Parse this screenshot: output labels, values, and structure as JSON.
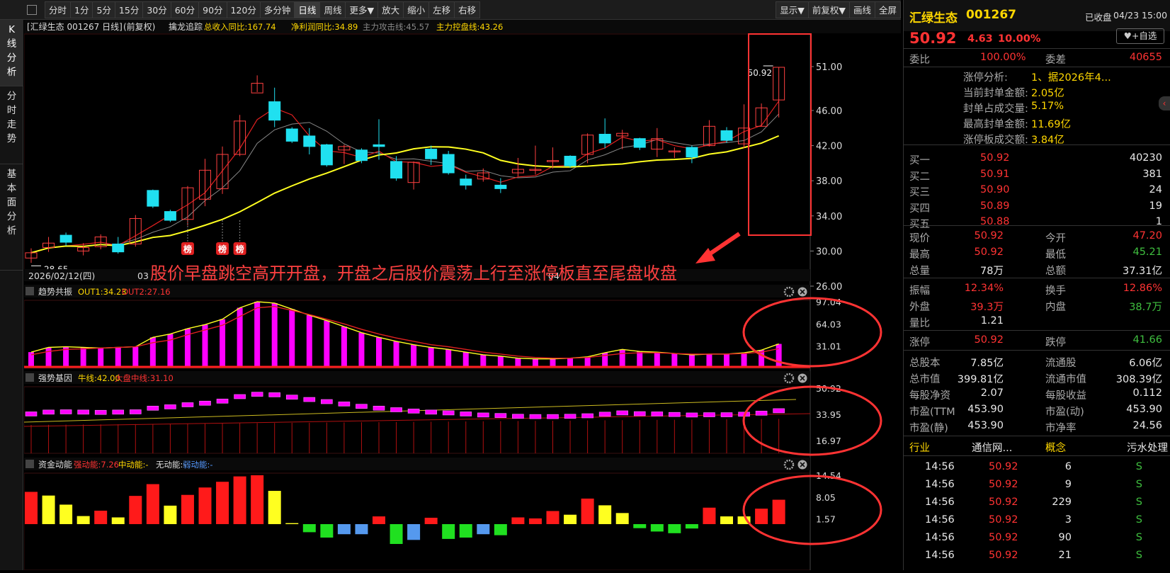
{
  "toolbar": {
    "items": [
      "分时",
      "1分",
      "5分",
      "15分",
      "30分",
      "60分",
      "90分",
      "120分",
      "多分钟",
      "日线",
      "周线",
      "更多▼",
      "放大",
      "缩小",
      "左移",
      "右移"
    ],
    "right_items": [
      "显示▼",
      "前复权▼",
      "画线",
      "全屏"
    ],
    "active": "日线"
  },
  "left_tabs": [
    [
      "K",
      "线",
      "分",
      "析"
    ],
    [
      "分",
      "时",
      "走",
      "势"
    ],
    [
      "基",
      "本",
      "面",
      "分",
      "析"
    ]
  ],
  "chart_header": {
    "title": "[汇绿生态 001267 日线]",
    "adj": "(前复权)",
    "indicator": "擒龙追踪",
    "total_revenue": "总收入同比:167.74",
    "net_profit": "净利润同比:34.89",
    "attack_line": "主力攻击线:45.57",
    "control_line": "主力控盘线:43.26"
  },
  "price_axis": [
    "51.00",
    "46.00",
    "42.00",
    "38.00",
    "34.00",
    "30.00",
    "26.00"
  ],
  "price_labels": {
    "high": "50.92",
    "low": "28.65"
  },
  "date_labels": {
    "start": "2026/02/12(四)",
    "m3": "03",
    "m4": "04"
  },
  "bang": [
    "榜",
    "榜",
    "榜"
  ],
  "annotation": "股价早盘跳空高开开盘，开盘之后股价震荡上行至涨停板直至尾盘收盘",
  "panel1": {
    "name": "趋势共振",
    "out1": "OUT1:34.23",
    "out2": "OUT2:27.16",
    "axis": [
      "97.04",
      "64.03",
      "31.01"
    ]
  },
  "panel2": {
    "name": "强势基因",
    "bull": "牛线:42.00",
    "market": "大盘中线:31.10",
    "axis": [
      "50.92",
      "33.95",
      "16.97"
    ]
  },
  "panel3": {
    "name": "资金动能",
    "strong": "强动能:7.26",
    "mid": "中动能:-",
    "none": "无动能:-",
    "weak": "弱动能:-",
    "axis": [
      "14.54",
      "8.05",
      "1.57"
    ]
  },
  "chart_data": {
    "type": "candlestick",
    "dates": {
      "start": "2026/02/12(四)"
    },
    "candles": [
      [
        29.2,
        29.8,
        30.3,
        28.65
      ],
      [
        30.4,
        30.9,
        31.6,
        29.9
      ],
      [
        31.8,
        31.0,
        32.1,
        30.6
      ],
      [
        30.0,
        30.4,
        30.9,
        29.5
      ],
      [
        30.5,
        31.6,
        31.9,
        30.2
      ],
      [
        30.8,
        29.9,
        31.6,
        29.7
      ],
      [
        30.8,
        33.7,
        34.1,
        30.5
      ],
      [
        36.9,
        35.1,
        37.0,
        34.9
      ],
      [
        34.5,
        33.5,
        34.7,
        33.3
      ],
      [
        33.6,
        37.2,
        37.4,
        32.9
      ],
      [
        35.9,
        39.2,
        40.5,
        35.1
      ],
      [
        37.1,
        41.0,
        41.9,
        36.5
      ],
      [
        41.0,
        44.8,
        45.5,
        40.8
      ],
      [
        48.0,
        49.1,
        50.0,
        48.1
      ],
      [
        47.0,
        44.9,
        48.6,
        44.1
      ],
      [
        43.9,
        42.5,
        44.1,
        42.3
      ],
      [
        43.1,
        41.9,
        44.0,
        41.0
      ],
      [
        42.1,
        39.8,
        42.2,
        39.6
      ],
      [
        41.5,
        41.9,
        42.1,
        39.9
      ],
      [
        41.5,
        40.3,
        41.7,
        40.0
      ],
      [
        42.1,
        41.9,
        45.0,
        40.4
      ],
      [
        40.2,
        38.3,
        40.8,
        38.0
      ],
      [
        37.8,
        40.1,
        40.2,
        37.0
      ],
      [
        41.6,
        40.5,
        42.0,
        39.8
      ],
      [
        41.0,
        38.9,
        41.4,
        38.7
      ],
      [
        38.2,
        37.5,
        38.7,
        37.0
      ],
      [
        38.2,
        38.9,
        39.4,
        37.9
      ],
      [
        37.5,
        37.1,
        38.3,
        36.6
      ],
      [
        38.9,
        39.3,
        40.6,
        38.5
      ],
      [
        39.3,
        39.3,
        42.0,
        38.7
      ],
      [
        40.2,
        40.3,
        41.8,
        39.4
      ],
      [
        40.8,
        39.7,
        40.9,
        39.5
      ],
      [
        41.0,
        43.2,
        43.4,
        40.0
      ],
      [
        43.3,
        42.3,
        45.1,
        41.7
      ],
      [
        43.1,
        43.4,
        43.8,
        41.6
      ],
      [
        42.8,
        41.8,
        42.9,
        41.5
      ],
      [
        41.6,
        42.8,
        44.0,
        40.7
      ],
      [
        41.3,
        41.4,
        41.8,
        40.6
      ],
      [
        41.8,
        40.7,
        42.0,
        40.0
      ],
      [
        42.0,
        44.2,
        44.9,
        41.9
      ],
      [
        43.7,
        42.6,
        44.1,
        42.3
      ],
      [
        42.2,
        44.0,
        46.7,
        41.7
      ],
      [
        44.2,
        46.3,
        46.8,
        44.2
      ],
      [
        47.2,
        50.92,
        50.92,
        45.21
      ]
    ],
    "panel1_out1": [
      22,
      29,
      30,
      29,
      28,
      29,
      30,
      44,
      49,
      57,
      63,
      71,
      88,
      97.04,
      95,
      86,
      77,
      69,
      60,
      51,
      44,
      38,
      33,
      29,
      26,
      22,
      18,
      16,
      13,
      12,
      12,
      13,
      15,
      21,
      26,
      23,
      22,
      20,
      18,
      19,
      19,
      21,
      25,
      34.23
    ],
    "panel1_out2": [
      18,
      23,
      26,
      27,
      28,
      29,
      30,
      36,
      40,
      48,
      55,
      62,
      75,
      88,
      90,
      84,
      78,
      71,
      64,
      56,
      49,
      43,
      38,
      33,
      30,
      26,
      22,
      19,
      16,
      14,
      13,
      13,
      14,
      17,
      20,
      21,
      21,
      20,
      19,
      19,
      19,
      20,
      22,
      27.16
    ],
    "panel3_bars": [
      {
        "v": 9.6,
        "c": "red"
      },
      {
        "v": 8.5,
        "c": "yellow"
      },
      {
        "v": 5.8,
        "c": "yellow"
      },
      {
        "v": 2.4,
        "c": "yellow"
      },
      {
        "v": 4.0,
        "c": "red"
      },
      {
        "v": 2.0,
        "c": "yellow"
      },
      {
        "v": 8.4,
        "c": "red"
      },
      {
        "v": 11.9,
        "c": "red"
      },
      {
        "v": 5.5,
        "c": "yellow"
      },
      {
        "v": 8.7,
        "c": "red"
      },
      {
        "v": 10.9,
        "c": "red"
      },
      {
        "v": 12.6,
        "c": "red"
      },
      {
        "v": 14.2,
        "c": "red"
      },
      {
        "v": 14.54,
        "c": "red"
      },
      {
        "v": 9.9,
        "c": "yellow"
      },
      {
        "v": 0.3,
        "c": "yellow"
      },
      {
        "v": -2.4,
        "c": "green"
      },
      {
        "v": -4.0,
        "c": "green"
      },
      {
        "v": -3.0,
        "c": "blue"
      },
      {
        "v": -3.0,
        "c": "blue"
      },
      {
        "v": 2.3,
        "c": "red"
      },
      {
        "v": -5.9,
        "c": "green"
      },
      {
        "v": -4.7,
        "c": "blue"
      },
      {
        "v": 1.9,
        "c": "red"
      },
      {
        "v": -4.4,
        "c": "green"
      },
      {
        "v": -4.0,
        "c": "green"
      },
      {
        "v": -3.0,
        "c": "blue"
      },
      {
        "v": -3.3,
        "c": "green"
      },
      {
        "v": 2.0,
        "c": "red"
      },
      {
        "v": 1.7,
        "c": "red"
      },
      {
        "v": 3.9,
        "c": "red"
      },
      {
        "v": 2.8,
        "c": "yellow"
      },
      {
        "v": 7.6,
        "c": "red"
      },
      {
        "v": 5.6,
        "c": "yellow"
      },
      {
        "v": 3.3,
        "c": "yellow"
      },
      {
        "v": -1.2,
        "c": "green"
      },
      {
        "v": -2.2,
        "c": "green"
      },
      {
        "v": -2.7,
        "c": "green"
      },
      {
        "v": -1.3,
        "c": "green"
      },
      {
        "v": 4.9,
        "c": "red"
      },
      {
        "v": 2.3,
        "c": "yellow"
      },
      {
        "v": 2.3,
        "c": "yellow"
      },
      {
        "v": 4.6,
        "c": "red"
      },
      {
        "v": 7.26,
        "c": "red"
      }
    ]
  },
  "quote": {
    "name": "汇绿生态",
    "code": "001267",
    "status": "已收盘",
    "datetime": "04/23 15:00",
    "price": "50.92",
    "change": "4.63",
    "pct": "10.00%",
    "watch": "+自选",
    "wb_label": "委比",
    "wb": "100.00%",
    "wc_label": "委差",
    "wc": "40655",
    "limit_rows": [
      [
        "涨停分析:",
        "1、据2026年4..."
      ],
      [
        "当前封单金额:",
        "2.05亿"
      ],
      [
        "封单占成交量:",
        "5.17%"
      ],
      [
        "最高封单金额:",
        "11.69亿"
      ],
      [
        "涨停板成交额:",
        "3.84亿"
      ]
    ],
    "bids": [
      [
        "买一",
        "50.92",
        "40230"
      ],
      [
        "买二",
        "50.91",
        "381"
      ],
      [
        "买三",
        "50.90",
        "24"
      ],
      [
        "买四",
        "50.89",
        "19"
      ],
      [
        "买五",
        "50.88",
        "1"
      ]
    ],
    "stats": [
      [
        "现价",
        "50.92",
        "今开",
        "47.20"
      ],
      [
        "最高",
        "50.92",
        "最低",
        "45.21"
      ],
      [
        "总量",
        "78万",
        "总额",
        "37.31亿"
      ]
    ],
    "stats2": [
      [
        "振幅",
        "12.34%",
        "换手",
        "12.86%"
      ],
      [
        "外盘",
        "39.3万",
        "内盘",
        "38.7万"
      ],
      [
        "量比",
        "1.21",
        "",
        ""
      ]
    ],
    "limits": [
      "涨停",
      "50.92",
      "跌停",
      "41.66"
    ],
    "fund": [
      [
        "总股本",
        "7.85亿",
        "流通股",
        "6.06亿"
      ],
      [
        "总市值",
        "399.81亿",
        "流通市值",
        "308.39亿"
      ],
      [
        "每股净资",
        "2.07",
        "每股收益",
        "0.112"
      ],
      [
        "市盈(TTM",
        "453.90",
        "市盈(动)",
        "453.90"
      ],
      [
        "市盈(静)",
        "453.90",
        "市净率",
        "24.56"
      ]
    ],
    "industry": [
      "行业",
      "通信网...",
      "概念",
      "污水处理"
    ],
    "ticks": [
      [
        "14:56",
        "50.92",
        "6",
        "S"
      ],
      [
        "14:56",
        "50.92",
        "9",
        "S"
      ],
      [
        "14:56",
        "50.92",
        "229",
        "S"
      ],
      [
        "14:56",
        "50.92",
        "3",
        "S"
      ],
      [
        "14:56",
        "50.92",
        "90",
        "S"
      ],
      [
        "14:56",
        "50.92",
        "21",
        "S"
      ]
    ]
  }
}
